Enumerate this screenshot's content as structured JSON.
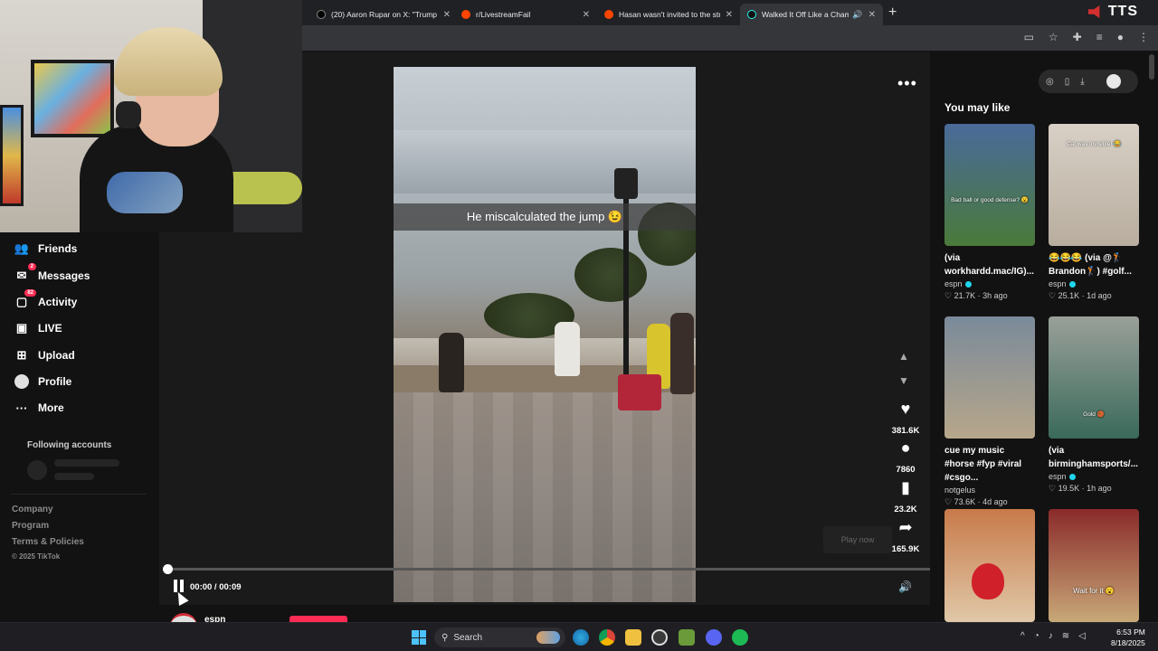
{
  "tabs": [
    {
      "label": "(20) Aaron Rupar on X: \"Trump",
      "favicon_color": "#000000"
    },
    {
      "label": "r/LivestreamFail",
      "favicon_color": "#ff4500"
    },
    {
      "label": "Hasan wasn't invited to the stre",
      "favicon_color": "#ff4500"
    },
    {
      "label": "Walked It Off Like a Champ",
      "favicon_color": "#111111"
    }
  ],
  "tts_label": "TTS",
  "sidebar": {
    "items": [
      {
        "label": "Friends",
        "icon": "friends-icon"
      },
      {
        "label": "Messages",
        "icon": "messages-icon",
        "badge": "2"
      },
      {
        "label": "Activity",
        "icon": "activity-icon",
        "badge": "82"
      },
      {
        "label": "LIVE",
        "icon": "live-icon"
      },
      {
        "label": "Upload",
        "icon": "upload-icon"
      },
      {
        "label": "Profile",
        "icon": "profile-icon"
      },
      {
        "label": "More",
        "icon": "more-icon"
      }
    ],
    "following_title": "Following accounts",
    "footer": [
      "Company",
      "Program",
      "Terms & Policies"
    ],
    "copyright": "© 2025 TikTok"
  },
  "video": {
    "caption": "He miscalculated the jump 😉",
    "likes": "381.6K",
    "comments": "7860",
    "saves": "23.2K",
    "shares": "165.9K",
    "play_now": "Play now",
    "time": "00:00 / 00:09",
    "progress": 0.0,
    "author": "espn"
  },
  "right_panel": {
    "heading": "You may like",
    "cards": [
      {
        "title": "(via workhardd.mac/IG)...",
        "author": "espn",
        "likes": "21.7K",
        "age": "3h ago",
        "thumb_text": "Bad ball or good defense? 😮",
        "colors": [
          "#4a6a9a",
          "#4a7a3a"
        ]
      },
      {
        "title": "😂😂😂 (via @🏌️ Brandon🏌️) #golf...",
        "author": "espn",
        "likes": "25.1K",
        "age": "1d ago",
        "thumb_text": "Cat was invisible! 😂",
        "colors": [
          "#d8d0c6",
          "#b8ad9e"
        ]
      },
      {
        "title": "cue my music #horse #fyp #viral #csgo...",
        "author": "notgelus",
        "likes": "73.6K",
        "age": "4d ago",
        "thumb_text": "",
        "colors": [
          "#7a8a9a",
          "#b7a68a"
        ]
      },
      {
        "title": "(via birminghamsports/...",
        "author": "espn",
        "likes": "19.5K",
        "age": "1h ago",
        "thumb_text": "Gold 🏀",
        "colors": [
          "#9aa09a",
          "#3a6a5a"
        ]
      },
      {
        "title": "",
        "author": "",
        "likes": "",
        "age": "",
        "thumb_text": "",
        "colors": [
          "#c87a4a",
          "#e0c8a8"
        ]
      },
      {
        "title": "",
        "author": "",
        "likes": "",
        "age": "",
        "thumb_text": "Wait for it 😮",
        "colors": [
          "#8a2a2a",
          "#c8a878"
        ]
      }
    ]
  },
  "taskbar": {
    "search_label": "Search",
    "time": "6:53 PM",
    "date": "8/18/2025"
  }
}
